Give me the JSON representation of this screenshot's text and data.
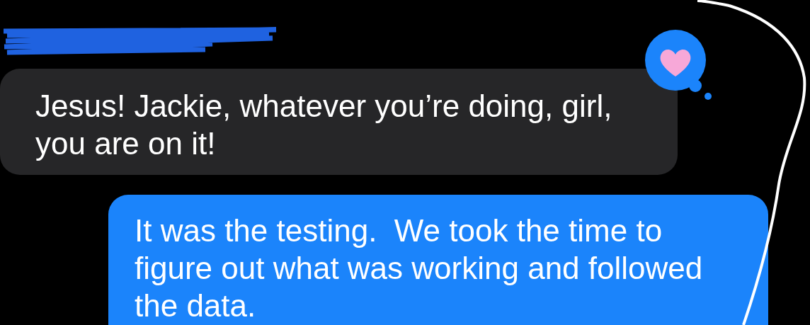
{
  "messages": [
    {
      "kind": "received",
      "text": "Jesus! Jackie, whatever you’re doing, girl, you are on it!"
    },
    {
      "kind": "sent",
      "text": "It was the testing.  We took the time to figure out what was working and followed the data."
    }
  ]
}
